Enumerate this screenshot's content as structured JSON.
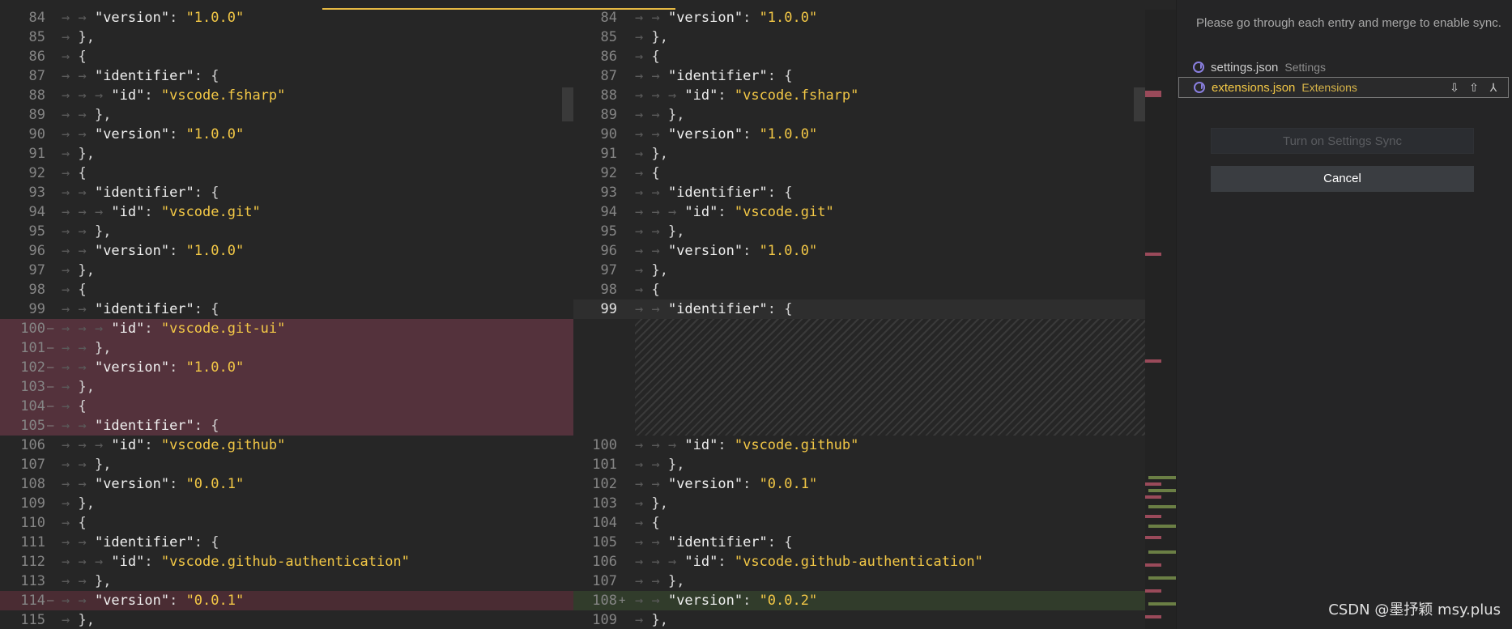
{
  "left_lines": [
    {
      "n": "84",
      "mark": "",
      "indent": 2,
      "tokens": [
        [
          "key",
          "\"version\""
        ],
        [
          "pun",
          ": "
        ],
        [
          "str",
          "\"1.0.0\""
        ]
      ],
      "diff": ""
    },
    {
      "n": "85",
      "mark": "",
      "indent": 1,
      "tokens": [
        [
          "pun",
          "},"
        ]
      ],
      "diff": ""
    },
    {
      "n": "86",
      "mark": "",
      "indent": 1,
      "tokens": [
        [
          "pun",
          "{"
        ]
      ],
      "diff": ""
    },
    {
      "n": "87",
      "mark": "",
      "indent": 2,
      "tokens": [
        [
          "key",
          "\"identifier\""
        ],
        [
          "pun",
          ": {"
        ]
      ],
      "diff": ""
    },
    {
      "n": "88",
      "mark": "",
      "indent": 3,
      "tokens": [
        [
          "key",
          "\"id\""
        ],
        [
          "pun",
          ": "
        ],
        [
          "str",
          "\"vscode.fsharp\""
        ]
      ],
      "diff": ""
    },
    {
      "n": "89",
      "mark": "",
      "indent": 2,
      "tokens": [
        [
          "pun",
          "},"
        ]
      ],
      "diff": ""
    },
    {
      "n": "90",
      "mark": "",
      "indent": 2,
      "tokens": [
        [
          "key",
          "\"version\""
        ],
        [
          "pun",
          ": "
        ],
        [
          "str",
          "\"1.0.0\""
        ]
      ],
      "diff": ""
    },
    {
      "n": "91",
      "mark": "",
      "indent": 1,
      "tokens": [
        [
          "pun",
          "},"
        ]
      ],
      "diff": ""
    },
    {
      "n": "92",
      "mark": "",
      "indent": 1,
      "tokens": [
        [
          "pun",
          "{"
        ]
      ],
      "diff": ""
    },
    {
      "n": "93",
      "mark": "",
      "indent": 2,
      "tokens": [
        [
          "key",
          "\"identifier\""
        ],
        [
          "pun",
          ": {"
        ]
      ],
      "diff": ""
    },
    {
      "n": "94",
      "mark": "",
      "indent": 3,
      "tokens": [
        [
          "key",
          "\"id\""
        ],
        [
          "pun",
          ": "
        ],
        [
          "str",
          "\"vscode.git\""
        ]
      ],
      "diff": ""
    },
    {
      "n": "95",
      "mark": "",
      "indent": 2,
      "tokens": [
        [
          "pun",
          "},"
        ]
      ],
      "diff": ""
    },
    {
      "n": "96",
      "mark": "",
      "indent": 2,
      "tokens": [
        [
          "key",
          "\"version\""
        ],
        [
          "pun",
          ": "
        ],
        [
          "str",
          "\"1.0.0\""
        ]
      ],
      "diff": ""
    },
    {
      "n": "97",
      "mark": "",
      "indent": 1,
      "tokens": [
        [
          "pun",
          "},"
        ]
      ],
      "diff": ""
    },
    {
      "n": "98",
      "mark": "",
      "indent": 1,
      "tokens": [
        [
          "pun",
          "{"
        ]
      ],
      "diff": ""
    },
    {
      "n": "99",
      "mark": "",
      "indent": 2,
      "tokens": [
        [
          "key",
          "\"identifier\""
        ],
        [
          "pun",
          ": {"
        ]
      ],
      "diff": ""
    },
    {
      "n": "100",
      "mark": "—",
      "indent": 3,
      "tokens": [
        [
          "key",
          "\"id\""
        ],
        [
          "pun",
          ": "
        ],
        [
          "str",
          "\"vscode.git-ui\""
        ]
      ],
      "diff": "del"
    },
    {
      "n": "101",
      "mark": "—",
      "indent": 2,
      "tokens": [
        [
          "pun",
          "},"
        ]
      ],
      "diff": "del"
    },
    {
      "n": "102",
      "mark": "—",
      "indent": 2,
      "tokens": [
        [
          "key",
          "\"version\""
        ],
        [
          "pun",
          ": "
        ],
        [
          "str",
          "\"1.0.0\""
        ]
      ],
      "diff": "del"
    },
    {
      "n": "103",
      "mark": "—",
      "indent": 1,
      "tokens": [
        [
          "pun",
          "},"
        ]
      ],
      "diff": "del"
    },
    {
      "n": "104",
      "mark": "—",
      "indent": 1,
      "tokens": [
        [
          "pun",
          "{"
        ]
      ],
      "diff": "del"
    },
    {
      "n": "105",
      "mark": "—",
      "indent": 2,
      "tokens": [
        [
          "key",
          "\"identifier\""
        ],
        [
          "pun",
          ": {"
        ]
      ],
      "diff": "del"
    },
    {
      "n": "106",
      "mark": "",
      "indent": 3,
      "tokens": [
        [
          "key",
          "\"id\""
        ],
        [
          "pun",
          ": "
        ],
        [
          "str",
          "\"vscode.github\""
        ]
      ],
      "diff": ""
    },
    {
      "n": "107",
      "mark": "",
      "indent": 2,
      "tokens": [
        [
          "pun",
          "},"
        ]
      ],
      "diff": ""
    },
    {
      "n": "108",
      "mark": "",
      "indent": 2,
      "tokens": [
        [
          "key",
          "\"version\""
        ],
        [
          "pun",
          ": "
        ],
        [
          "str",
          "\"0.0.1\""
        ]
      ],
      "diff": ""
    },
    {
      "n": "109",
      "mark": "",
      "indent": 1,
      "tokens": [
        [
          "pun",
          "},"
        ]
      ],
      "diff": ""
    },
    {
      "n": "110",
      "mark": "",
      "indent": 1,
      "tokens": [
        [
          "pun",
          "{"
        ]
      ],
      "diff": ""
    },
    {
      "n": "111",
      "mark": "",
      "indent": 2,
      "tokens": [
        [
          "key",
          "\"identifier\""
        ],
        [
          "pun",
          ": {"
        ]
      ],
      "diff": ""
    },
    {
      "n": "112",
      "mark": "",
      "indent": 3,
      "tokens": [
        [
          "key",
          "\"id\""
        ],
        [
          "pun",
          ": "
        ],
        [
          "str",
          "\"vscode.github-authentication\""
        ]
      ],
      "diff": ""
    },
    {
      "n": "113",
      "mark": "",
      "indent": 2,
      "tokens": [
        [
          "pun",
          "},"
        ]
      ],
      "diff": ""
    },
    {
      "n": "114",
      "mark": "—",
      "indent": 2,
      "tokens": [
        [
          "key",
          "\"version\""
        ],
        [
          "pun",
          ": "
        ],
        [
          "str",
          "\"0.0.1\""
        ]
      ],
      "diff": "delline"
    },
    {
      "n": "115",
      "mark": "",
      "indent": 1,
      "tokens": [
        [
          "pun",
          "},"
        ]
      ],
      "diff": ""
    }
  ],
  "right_lines": [
    {
      "n": "84",
      "mark": "",
      "indent": 2,
      "tokens": [
        [
          "key",
          "\"version\""
        ],
        [
          "pun",
          ": "
        ],
        [
          "str",
          "\"1.0.0\""
        ]
      ],
      "diff": ""
    },
    {
      "n": "85",
      "mark": "",
      "indent": 1,
      "tokens": [
        [
          "pun",
          "},"
        ]
      ],
      "diff": ""
    },
    {
      "n": "86",
      "mark": "",
      "indent": 1,
      "tokens": [
        [
          "pun",
          "{"
        ]
      ],
      "diff": ""
    },
    {
      "n": "87",
      "mark": "",
      "indent": 2,
      "tokens": [
        [
          "key",
          "\"identifier\""
        ],
        [
          "pun",
          ": {"
        ]
      ],
      "diff": ""
    },
    {
      "n": "88",
      "mark": "",
      "indent": 3,
      "tokens": [
        [
          "key",
          "\"id\""
        ],
        [
          "pun",
          ": "
        ],
        [
          "str",
          "\"vscode.fsharp\""
        ]
      ],
      "diff": ""
    },
    {
      "n": "89",
      "mark": "",
      "indent": 2,
      "tokens": [
        [
          "pun",
          "},"
        ]
      ],
      "diff": ""
    },
    {
      "n": "90",
      "mark": "",
      "indent": 2,
      "tokens": [
        [
          "key",
          "\"version\""
        ],
        [
          "pun",
          ": "
        ],
        [
          "str",
          "\"1.0.0\""
        ]
      ],
      "diff": ""
    },
    {
      "n": "91",
      "mark": "",
      "indent": 1,
      "tokens": [
        [
          "pun",
          "},"
        ]
      ],
      "diff": ""
    },
    {
      "n": "92",
      "mark": "",
      "indent": 1,
      "tokens": [
        [
          "pun",
          "{"
        ]
      ],
      "diff": ""
    },
    {
      "n": "93",
      "mark": "",
      "indent": 2,
      "tokens": [
        [
          "key",
          "\"identifier\""
        ],
        [
          "pun",
          ": {"
        ]
      ],
      "diff": ""
    },
    {
      "n": "94",
      "mark": "",
      "indent": 3,
      "tokens": [
        [
          "key",
          "\"id\""
        ],
        [
          "pun",
          ": "
        ],
        [
          "str",
          "\"vscode.git\""
        ]
      ],
      "diff": ""
    },
    {
      "n": "95",
      "mark": "",
      "indent": 2,
      "tokens": [
        [
          "pun",
          "},"
        ]
      ],
      "diff": ""
    },
    {
      "n": "96",
      "mark": "",
      "indent": 2,
      "tokens": [
        [
          "key",
          "\"version\""
        ],
        [
          "pun",
          ": "
        ],
        [
          "str",
          "\"1.0.0\""
        ]
      ],
      "diff": ""
    },
    {
      "n": "97",
      "mark": "",
      "indent": 1,
      "tokens": [
        [
          "pun",
          "},"
        ]
      ],
      "diff": ""
    },
    {
      "n": "98",
      "mark": "",
      "indent": 1,
      "tokens": [
        [
          "pun",
          "{"
        ]
      ],
      "diff": ""
    },
    {
      "n": "99",
      "mark": "",
      "indent": 2,
      "tokens": [
        [
          "key",
          "\"identifier\""
        ],
        [
          "pun",
          ": {"
        ]
      ],
      "diff": "cur"
    },
    {
      "n": "",
      "mark": "",
      "indent": 0,
      "tokens": [],
      "diff": "hatch"
    },
    {
      "n": "",
      "mark": "",
      "indent": 0,
      "tokens": [],
      "diff": "hatch"
    },
    {
      "n": "",
      "mark": "",
      "indent": 0,
      "tokens": [],
      "diff": "hatch"
    },
    {
      "n": "",
      "mark": "",
      "indent": 0,
      "tokens": [],
      "diff": "hatch"
    },
    {
      "n": "",
      "mark": "",
      "indent": 0,
      "tokens": [],
      "diff": "hatch"
    },
    {
      "n": "",
      "mark": "",
      "indent": 0,
      "tokens": [],
      "diff": "hatch"
    },
    {
      "n": "100",
      "mark": "",
      "indent": 3,
      "tokens": [
        [
          "key",
          "\"id\""
        ],
        [
          "pun",
          ": "
        ],
        [
          "str",
          "\"vscode.github\""
        ]
      ],
      "diff": ""
    },
    {
      "n": "101",
      "mark": "",
      "indent": 2,
      "tokens": [
        [
          "pun",
          "},"
        ]
      ],
      "diff": ""
    },
    {
      "n": "102",
      "mark": "",
      "indent": 2,
      "tokens": [
        [
          "key",
          "\"version\""
        ],
        [
          "pun",
          ": "
        ],
        [
          "str",
          "\"0.0.1\""
        ]
      ],
      "diff": ""
    },
    {
      "n": "103",
      "mark": "",
      "indent": 1,
      "tokens": [
        [
          "pun",
          "},"
        ]
      ],
      "diff": ""
    },
    {
      "n": "104",
      "mark": "",
      "indent": 1,
      "tokens": [
        [
          "pun",
          "{"
        ]
      ],
      "diff": ""
    },
    {
      "n": "105",
      "mark": "",
      "indent": 2,
      "tokens": [
        [
          "key",
          "\"identifier\""
        ],
        [
          "pun",
          ": {"
        ]
      ],
      "diff": ""
    },
    {
      "n": "106",
      "mark": "",
      "indent": 3,
      "tokens": [
        [
          "key",
          "\"id\""
        ],
        [
          "pun",
          ": "
        ],
        [
          "str",
          "\"vscode.github-authentication\""
        ]
      ],
      "diff": ""
    },
    {
      "n": "107",
      "mark": "",
      "indent": 2,
      "tokens": [
        [
          "pun",
          "},"
        ]
      ],
      "diff": ""
    },
    {
      "n": "108",
      "mark": "+",
      "indent": 2,
      "tokens": [
        [
          "key",
          "\"version\""
        ],
        [
          "pun",
          ": "
        ],
        [
          "str",
          "\"0.0.2\""
        ]
      ],
      "diff": "ins"
    },
    {
      "n": "109",
      "mark": "",
      "indent": 1,
      "tokens": [
        [
          "pun",
          "},"
        ]
      ],
      "diff": ""
    }
  ],
  "sync_panel": {
    "message": "Please go through each entry and merge to enable sync.",
    "entries": [
      {
        "name": "settings.json",
        "desc": "Settings",
        "selected": false
      },
      {
        "name": "extensions.json",
        "desc": "Extensions",
        "selected": true
      }
    ],
    "entry_actions": [
      "cloud-download-icon",
      "cloud-upload-icon",
      "merge-icon"
    ],
    "primary_button": "Turn on Settings Sync",
    "cancel_button": "Cancel"
  },
  "watermark": "CSDN @墨抒颖 msy.plus",
  "colors": {
    "background": "#262626",
    "deleted": "#54323c",
    "inserted": "#313c2b",
    "string": "#f3c846",
    "selected_entry": "#f3c846",
    "tab_accent": "#e5b843"
  }
}
